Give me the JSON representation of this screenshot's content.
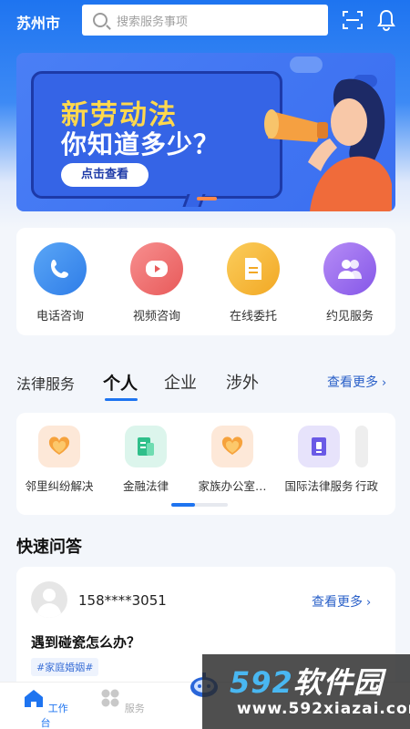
{
  "header": {
    "city": "苏州市",
    "search_placeholder": "搜索服务事项"
  },
  "banner": {
    "title_line1": "新劳动法",
    "title_line2": "你知道多少？",
    "button": "点击查看"
  },
  "services": [
    {
      "label": "电话咨询",
      "icon": "phone-icon",
      "color": "#3b8ff3"
    },
    {
      "label": "视频咨询",
      "icon": "video-icon",
      "color": "#f07171"
    },
    {
      "label": "在线委托",
      "icon": "document-icon",
      "color": "#f5b93a"
    },
    {
      "label": "约见服务",
      "icon": "people-icon",
      "color": "#9a6ef0"
    }
  ],
  "legal_tabs": {
    "title": "法律服务",
    "tabs": [
      "个人",
      "企业",
      "涉外"
    ],
    "active": "个人",
    "more": "查看更多"
  },
  "legal_items": [
    {
      "label": "邻里纠纷解决",
      "icon": "heart-hands-icon",
      "color": "#fde8d8"
    },
    {
      "label": "金融法律",
      "icon": "finance-doc-icon",
      "color": "#dcf5ec"
    },
    {
      "label": "家族办公室…",
      "icon": "heart-hands-icon",
      "color": "#fde8d8"
    },
    {
      "label": "国际法律服务",
      "icon": "book-icon",
      "color": "#e7e3fb"
    },
    {
      "label": "行政",
      "icon": "generic-icon",
      "color": "#eeeeee"
    }
  ],
  "qa": {
    "title": "快速问答",
    "user": "158****3051",
    "more": "查看更多",
    "question": "遇到碰瓷怎么办？",
    "tag": "#家庭婚姻#"
  },
  "bottom_nav": [
    {
      "label": "工作台",
      "icon": "home-icon",
      "active": true
    },
    {
      "label": "服务",
      "icon": "grid-icon",
      "active": false
    }
  ],
  "watermark": {
    "brand_num": "592",
    "brand_text": "软件园",
    "url": "www.592xiazai.com"
  }
}
